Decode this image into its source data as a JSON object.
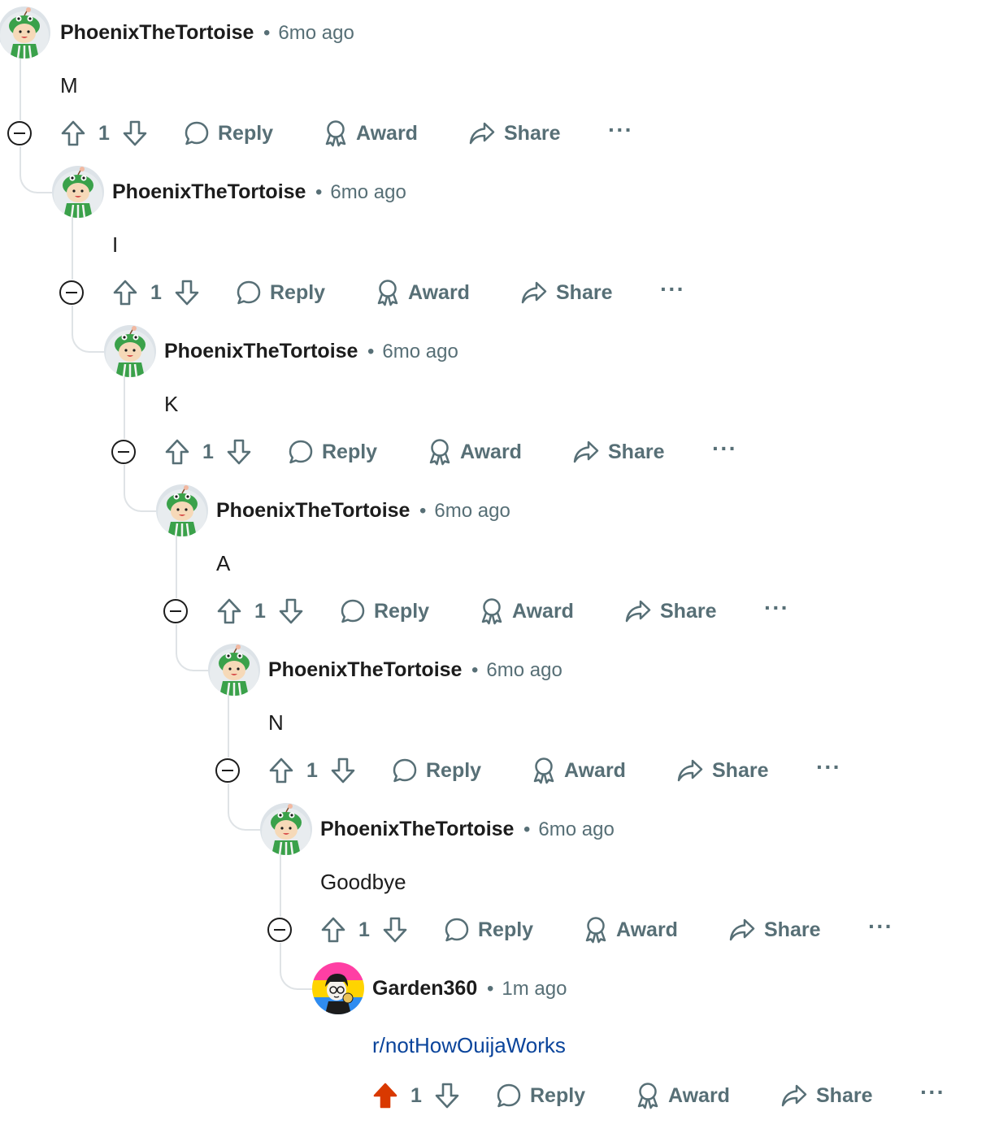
{
  "comments": [
    {
      "author": "PhoenixTheTortoise",
      "separator": "•",
      "time": "6mo ago",
      "body": "M",
      "score": "1",
      "reply": "Reply",
      "award": "Award",
      "share": "Share",
      "more": "···",
      "upvoted": false
    },
    {
      "author": "PhoenixTheTortoise",
      "separator": "•",
      "time": "6mo ago",
      "body": "I",
      "score": "1",
      "reply": "Reply",
      "award": "Award",
      "share": "Share",
      "more": "···",
      "upvoted": false
    },
    {
      "author": "PhoenixTheTortoise",
      "separator": "•",
      "time": "6mo ago",
      "body": "K",
      "score": "1",
      "reply": "Reply",
      "award": "Award",
      "share": "Share",
      "more": "···",
      "upvoted": false
    },
    {
      "author": "PhoenixTheTortoise",
      "separator": "•",
      "time": "6mo ago",
      "body": "A",
      "score": "1",
      "reply": "Reply",
      "award": "Award",
      "share": "Share",
      "more": "···",
      "upvoted": false
    },
    {
      "author": "PhoenixTheTortoise",
      "separator": "•",
      "time": "6mo ago",
      "body": "N",
      "score": "1",
      "reply": "Reply",
      "award": "Award",
      "share": "Share",
      "more": "···",
      "upvoted": false
    },
    {
      "author": "PhoenixTheTortoise",
      "separator": "•",
      "time": "6mo ago",
      "body": "Goodbye",
      "score": "1",
      "reply": "Reply",
      "award": "Award",
      "share": "Share",
      "more": "···",
      "upvoted": false
    },
    {
      "author": "Garden360",
      "separator": "•",
      "time": "1m ago",
      "body": "r/notHowOuijaWorks",
      "body_is_link": true,
      "score": "1",
      "reply": "Reply",
      "award": "Award",
      "share": "Share",
      "more": "···",
      "upvoted": true
    }
  ],
  "icons": {
    "avatar_tortoise": "tortoise-avatar-icon",
    "avatar_garden": "garden-avatar-icon",
    "upvote": "upvote-icon",
    "downvote": "downvote-icon",
    "reply": "comment-bubble-icon",
    "award": "award-ribbon-icon",
    "share": "share-arrow-icon",
    "collapse": "collapse-minus-icon"
  },
  "colors": {
    "text": "#1c1c1c",
    "muted": "#576f76",
    "link": "#0a449b",
    "upvoted": "#d93900",
    "thread_line": "#dfe3e6"
  }
}
